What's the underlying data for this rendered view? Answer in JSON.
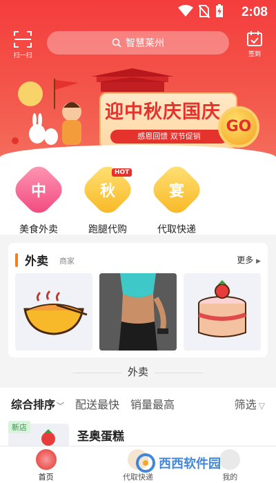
{
  "status_bar": {
    "time": "2:08"
  },
  "header": {
    "scan_label": "扫一扫",
    "search_placeholder": "智慧莱州",
    "checkin_label": "签到"
  },
  "banner": {
    "title": "迎中秋庆国庆",
    "subtitle": "感恩回馈 双节促销",
    "go_label": "GO"
  },
  "categories": [
    {
      "glyph": "中",
      "label": "美食外卖",
      "color": "red"
    },
    {
      "glyph": "秋",
      "label": "跑腿代购",
      "color": "yellow",
      "badge": "HOT"
    },
    {
      "glyph": "宴",
      "label": "代取快递",
      "color": "yellow"
    }
  ],
  "takeout_section": {
    "title": "外卖",
    "subtitle": "商家",
    "more_label": "更多"
  },
  "list_divider": "外卖",
  "sort_bar": {
    "items": [
      "综合排序",
      "配送最快",
      "销量最高"
    ],
    "filter_label": "筛选"
  },
  "shop": {
    "tag": "新店",
    "name": "圣奥蛋糕"
  },
  "tabs": [
    {
      "label": "首页",
      "active": true
    },
    {
      "label": "代取快递",
      "active": false
    },
    {
      "label": "我的",
      "active": false
    }
  ],
  "watermark": "西西软件园",
  "colors": {
    "primary_red": "#f43d3d",
    "accent_orange": "#f08021"
  }
}
